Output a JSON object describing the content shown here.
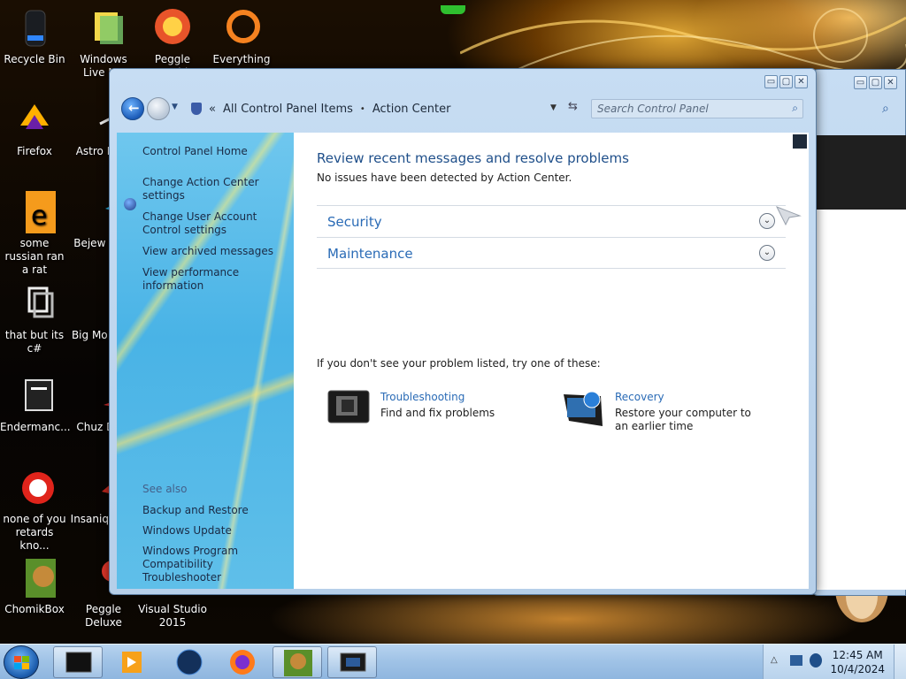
{
  "desktop": {
    "icons": [
      {
        "label": "Recycle Bin",
        "icon": "recycle-bin-icon"
      },
      {
        "label": "Windows Live Ma",
        "icon": "windows-live-mail-icon"
      },
      {
        "label": "Peggle World",
        "icon": "peggle-world-icon"
      },
      {
        "label": "Everything",
        "icon": "everything-search-icon"
      },
      {
        "label": "Firefox",
        "icon": "firefox-icon"
      },
      {
        "label": "Astro Delu",
        "icon": "astro-game-icon"
      },
      {
        "label": "some russian ran a rat",
        "icon": "shortcut-icon"
      },
      {
        "label": "Bejew Delu",
        "icon": "bejeweled-icon"
      },
      {
        "label": "that but its c#",
        "icon": "shortcut-icon"
      },
      {
        "label": "Big Mo Delu",
        "icon": "game-icon"
      },
      {
        "label": "Endermanc...",
        "icon": "app-icon"
      },
      {
        "label": "Chuz Delu",
        "icon": "game-icon"
      },
      {
        "label": "none of you retards kno...",
        "icon": "app-icon"
      },
      {
        "label": "Insaniq Delu",
        "icon": "game-icon"
      },
      {
        "label": "ChomikBox",
        "icon": "chomikbox-icon"
      },
      {
        "label": "Peggle Deluxe",
        "icon": "peggle-deluxe-icon"
      },
      {
        "label": "Visual Studio 2015",
        "icon": "visual-studio-icon"
      }
    ]
  },
  "window": {
    "controls": {
      "minimize": "▭",
      "maximize": "▢",
      "close": "✕"
    },
    "breadcrumb": {
      "prefix": "«",
      "parent": "All Control Panel Items",
      "separator": "•",
      "current": "Action Center"
    },
    "search_placeholder": "Search Control Panel",
    "sidebar": {
      "home": "Control Panel Home",
      "links": [
        "Change Action Center settings",
        "Change User Account Control settings",
        "View archived messages",
        "View performance information"
      ],
      "see_also_heading": "See also",
      "see_also": [
        "Backup and Restore",
        "Windows Update",
        "Windows Program Compatibility Troubleshooter"
      ]
    },
    "main": {
      "heading": "Review recent messages and resolve problems",
      "status": "No issues have been detected by Action Center.",
      "sections": [
        "Security",
        "Maintenance"
      ],
      "hint": "If you don't see your problem listed, try one of these:",
      "tools": [
        {
          "name": "Troubleshooting",
          "description": "Find and fix problems",
          "icon": "troubleshooting-icon"
        },
        {
          "name": "Recovery",
          "description": "Restore your computer to an earlier time",
          "icon": "recovery-icon"
        }
      ]
    }
  },
  "taskbar": {
    "start_icon": "windows-start-icon",
    "pinned": [
      "explorer-window-icon",
      "media-player-icon",
      "globe-browser-icon",
      "firefox-icon",
      "chomikbox-icon",
      "control-panel-window-icon"
    ],
    "clock": {
      "time": "12:45 AM",
      "date": "10/4/2024"
    }
  },
  "colors": {
    "accent_link": "#2a6bb6",
    "heading": "#1f4f8a",
    "sidebar": "#49b3e6"
  }
}
